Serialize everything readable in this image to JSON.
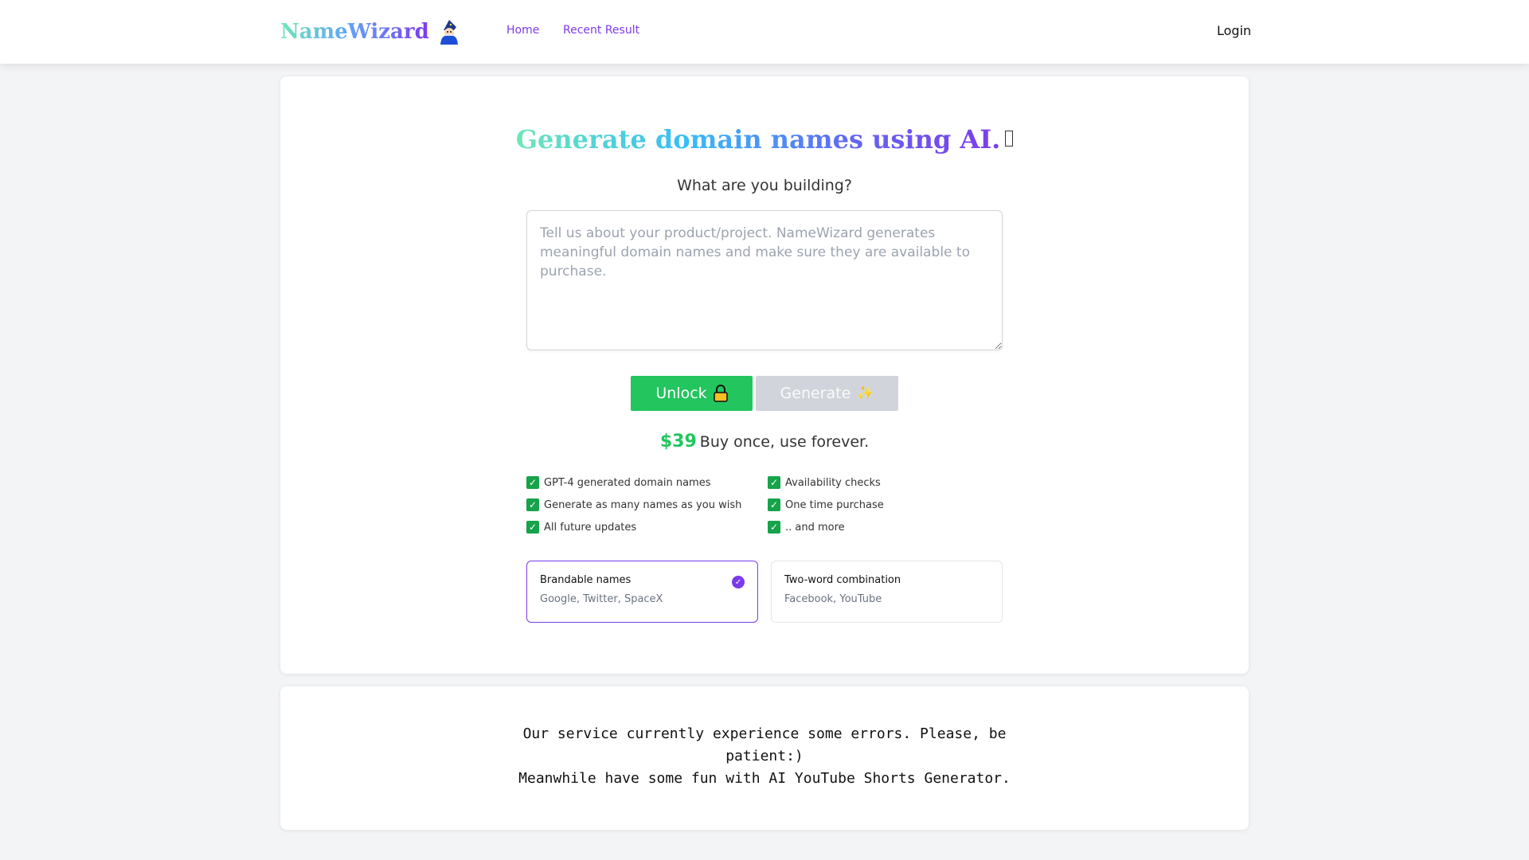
{
  "nav": {
    "logo_text": "NameWizard",
    "logo_icon": "wizard-icon",
    "links": [
      {
        "label": "Home"
      },
      {
        "label": "Recent Result"
      }
    ],
    "login_label": "Login"
  },
  "hero": {
    "headline": "Generate domain names using AI.",
    "subhead": "What are you building?",
    "prompt_placeholder": "Tell us about your product/project. NameWizard generates meaningful domain names and make sure they are available to purchase."
  },
  "actions": {
    "unlock_label": "Unlock",
    "unlock_icon": "lock-icon",
    "generate_label": "Generate",
    "generate_icon": "sparkle-icon"
  },
  "pricing": {
    "price": "$39",
    "tagline": "Buy once, use forever."
  },
  "features": [
    "GPT-4 generated domain names",
    "Availability checks",
    "Generate as many names as you wish",
    "One time purchase",
    "All future updates",
    ".. and more"
  ],
  "options": [
    {
      "title": "Brandable names",
      "examples": "Google, Twitter, SpaceX",
      "selected": true
    },
    {
      "title": "Two-word combination",
      "examples": "Facebook, YouTube",
      "selected": false
    }
  ],
  "notice": {
    "line1": "Our service currently experience some errors. Please, be patient:)",
    "line2": "Meanwhile have some fun with AI YouTube Shorts Generator."
  },
  "colors": {
    "accent": "#7c3aed",
    "success": "#22c55e",
    "disabled": "#d1d5db"
  }
}
